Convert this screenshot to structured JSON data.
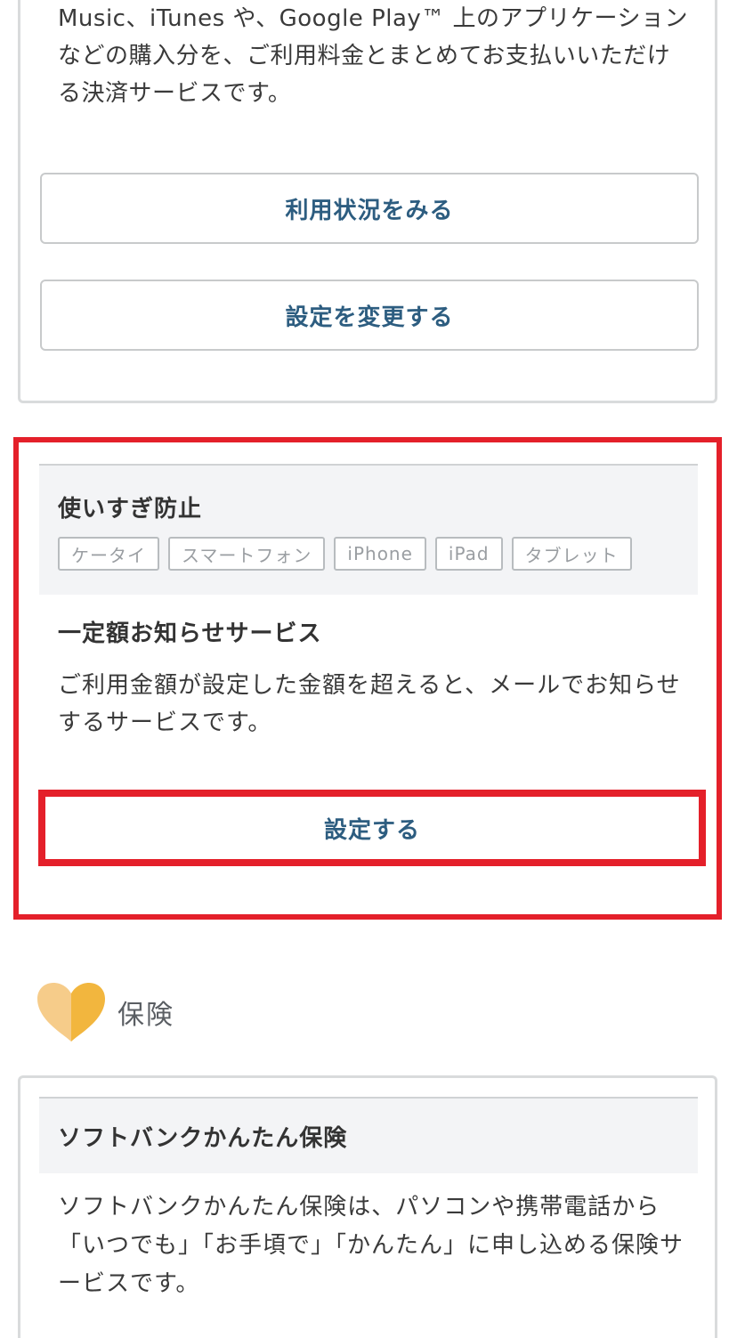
{
  "carrier_payment": {
    "description": "Music、iTunes や、Google Play™ 上のアプリケーションなどの購入分を、ご利用料金とまとめてお支払いいただける決済サービスです。",
    "usage_button": "利用状況をみる",
    "change_button": "設定を変更する"
  },
  "usage_alert": {
    "category": "使いすぎ防止",
    "tags": [
      "ケータイ",
      "スマートフォン",
      "iPhone",
      "iPad",
      "タブレット"
    ],
    "service_title": "一定額お知らせサービス",
    "service_description": "ご利用金額が設定した金額を超えると、メールでお知らせするサービスです。",
    "setup_button": "設定する",
    "highlight_color": "#e4202a"
  },
  "insurance_section": {
    "icon": "heart-icon",
    "heading": "保険",
    "card": {
      "title": "ソフトバンクかんたん保険",
      "description": "ソフトバンクかんたん保険は、パソコンや携帯電話から「いつでも」「お手頃で」「かんたん」に申し込める保険サービスです。"
    }
  },
  "colors": {
    "button_text": "#2d5d80",
    "heart_light": "#f6cc8a",
    "heart_dark": "#f2b63e",
    "card_header_bg": "#f3f4f6"
  }
}
